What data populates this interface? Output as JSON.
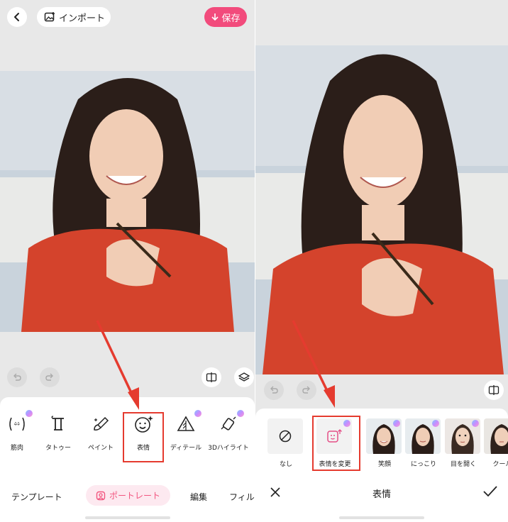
{
  "left": {
    "import_label": "インポート",
    "save_label": "保存",
    "tools": [
      {
        "label": "筋肉",
        "icon": "muscle-icon",
        "premium": true
      },
      {
        "label": "タトゥー",
        "icon": "tattoo-icon",
        "premium": false
      },
      {
        "label": "ペイント",
        "icon": "paint-icon",
        "premium": false
      },
      {
        "label": "表情",
        "icon": "smile-sparkle-icon",
        "premium": false
      },
      {
        "label": "ディテール",
        "icon": "detail-icon",
        "premium": true
      },
      {
        "label": "3Dハイライト",
        "icon": "3d-highlight-icon",
        "premium": true
      }
    ],
    "tabs": [
      "テンプレート",
      "ポートレート",
      "編集",
      "フィル"
    ],
    "active_tab": "ポートレート"
  },
  "right": {
    "options": [
      {
        "label": "なし",
        "icon": "none-icon"
      },
      {
        "label": "表情を変更",
        "icon": "change-expression-icon",
        "premium": true
      },
      {
        "label": "笑顔",
        "icon": "thumbnail",
        "premium": true
      },
      {
        "label": "にっこり",
        "icon": "thumbnail",
        "premium": true
      },
      {
        "label": "目を開く",
        "icon": "thumbnail",
        "premium": true
      },
      {
        "label": "クール",
        "icon": "thumbnail",
        "premium": true
      }
    ],
    "footer_title": "表情"
  },
  "colors": {
    "accent": "#f24b7c",
    "highlight_box": "#e53b2f"
  }
}
